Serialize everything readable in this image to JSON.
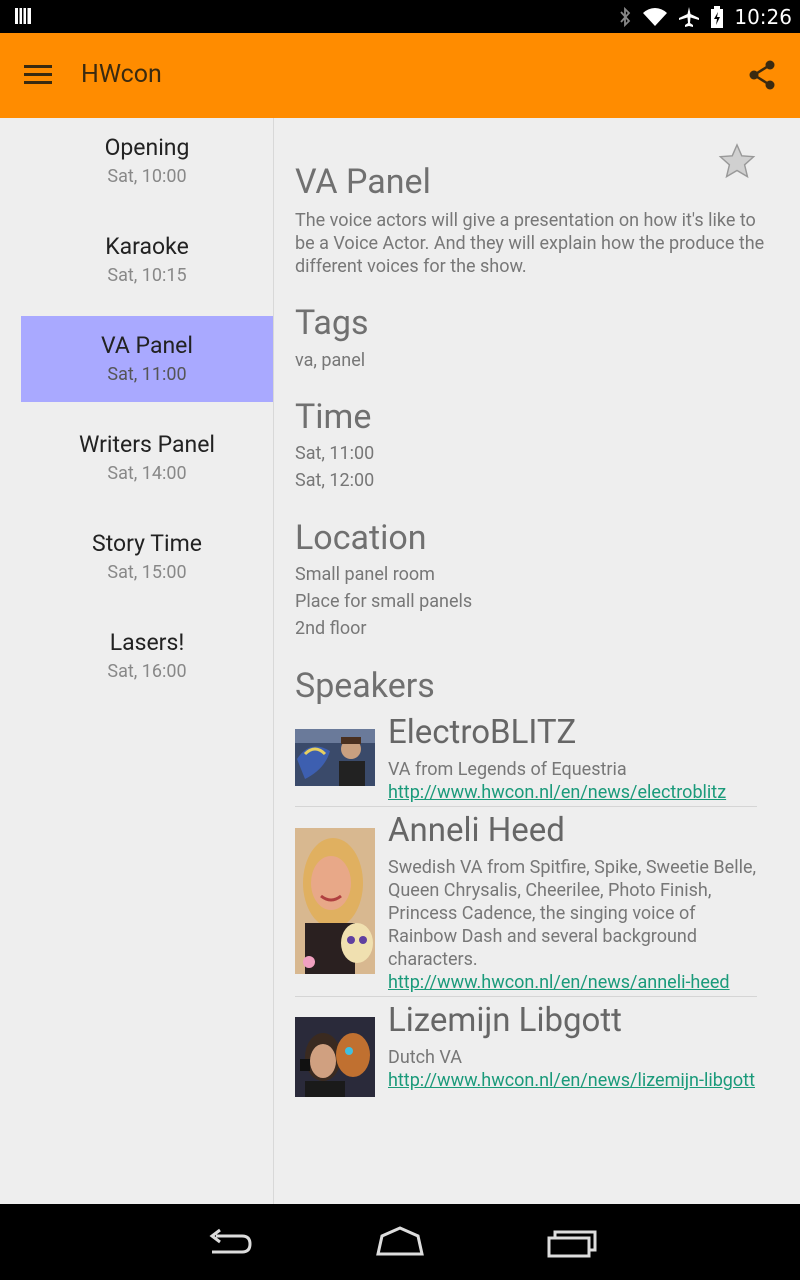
{
  "status_bar": {
    "time": "10:26"
  },
  "app_bar": {
    "title": "HWcon"
  },
  "sessions": [
    {
      "title": "Opening",
      "time": "Sat, 10:00",
      "selected": false
    },
    {
      "title": "Karaoke",
      "time": "Sat, 10:15",
      "selected": false
    },
    {
      "title": "VA Panel",
      "time": "Sat, 11:00",
      "selected": true
    },
    {
      "title": "Writers Panel",
      "time": "Sat, 14:00",
      "selected": false
    },
    {
      "title": "Story Time",
      "time": "Sat, 15:00",
      "selected": false
    },
    {
      "title": "Lasers!",
      "time": "Sat, 16:00",
      "selected": false
    }
  ],
  "detail": {
    "title": "VA Panel",
    "description": "The voice actors will give a presentation on how it's like to be a Voice Actor. And they will explain how the produce the different voices for the show.",
    "tags_heading": "Tags",
    "tags": "va, panel",
    "time_heading": "Time",
    "time_start": "Sat, 11:00",
    "time_end": "Sat, 12:00",
    "location_heading": "Location",
    "location_name": "Small panel room",
    "location_desc": "Place for small panels",
    "location_floor": "2nd floor",
    "speakers_heading": "Speakers",
    "speakers": [
      {
        "name": "ElectroBLITZ",
        "desc": "VA from Legends of Equestria",
        "link": "http://www.hwcon.nl/en/news/electroblitz"
      },
      {
        "name": "Anneli Heed",
        "desc": "Swedish VA from Spitfire, Spike, Sweetie Belle, Queen Chrysalis, Cheerilee, Photo Finish, Princess Cadence, the singing voice of Rainbow Dash and several background characters.",
        "link": "http://www.hwcon.nl/en/news/anneli-heed"
      },
      {
        "name": "Lizemijn Libgott",
        "desc": "Dutch VA",
        "link": "http://www.hwcon.nl/en/news/lizemijn-libgott"
      }
    ]
  },
  "colors": {
    "accent": "#ff8c00",
    "selected": "#a9a9ff",
    "link": "#1a9a7a"
  }
}
